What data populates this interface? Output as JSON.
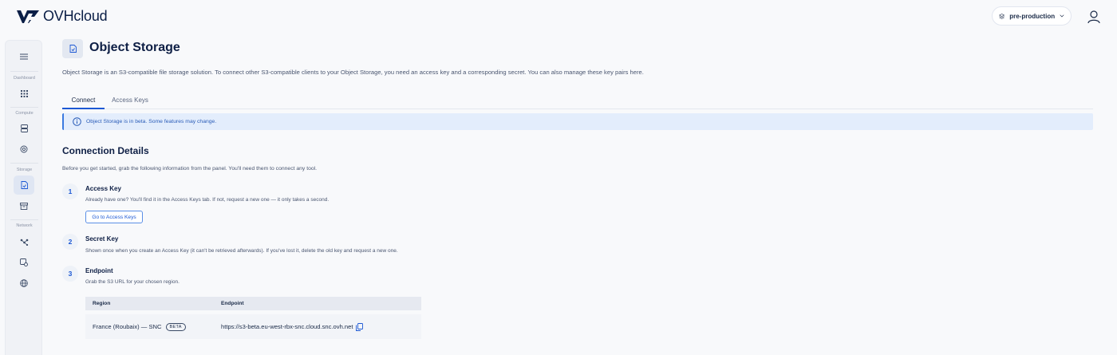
{
  "brand": {
    "name": "OVHcloud"
  },
  "header": {
    "environment": "pre-production"
  },
  "sidebar": {
    "groups": [
      {
        "label": "Dashboard"
      },
      {
        "label": "Compute"
      },
      {
        "label": "Storage"
      },
      {
        "label": "Network"
      }
    ]
  },
  "page": {
    "title": "Object Storage",
    "intro": "Object Storage is an S3-compatible file storage solution. To connect other S3-compatible clients to your Object Storage, you need an access key and a corresponding secret. You can also manage these key pairs here."
  },
  "tabs": [
    {
      "label": "Connect",
      "active": true
    },
    {
      "label": "Access Keys",
      "active": false
    }
  ],
  "banner": {
    "text": "Object Storage is in beta. Some features may change."
  },
  "connection": {
    "title": "Connection Details",
    "description": "Before you get started, grab the following information from the panel. You'll need them to connect any tool.",
    "steps": [
      {
        "number": "1",
        "title": "Access Key",
        "description": "Already have one? You'll find it in the Access Keys tab. If not, request a new one — it only takes a second.",
        "button": "Go to Access Keys"
      },
      {
        "number": "2",
        "title": "Secret Key",
        "description": "Shown once when you create an Access Key (it can't be retrieved afterwards). If you've lost it, delete the old key and request a new one."
      },
      {
        "number": "3",
        "title": "Endpoint",
        "description": "Grab the S3 URL for your chosen region."
      }
    ],
    "table": {
      "headers": [
        "Region",
        "Endpoint"
      ],
      "rows": [
        {
          "region": "France (Roubaix) — SNC",
          "badge": "BETA",
          "endpoint": "https://s3-beta.eu-west-rbx-snc.cloud.snc.ovh.net"
        }
      ]
    }
  },
  "colors": {
    "accent": "#1c58d4",
    "banner_bg": "#e3edfc",
    "text": "#0e1f45"
  }
}
